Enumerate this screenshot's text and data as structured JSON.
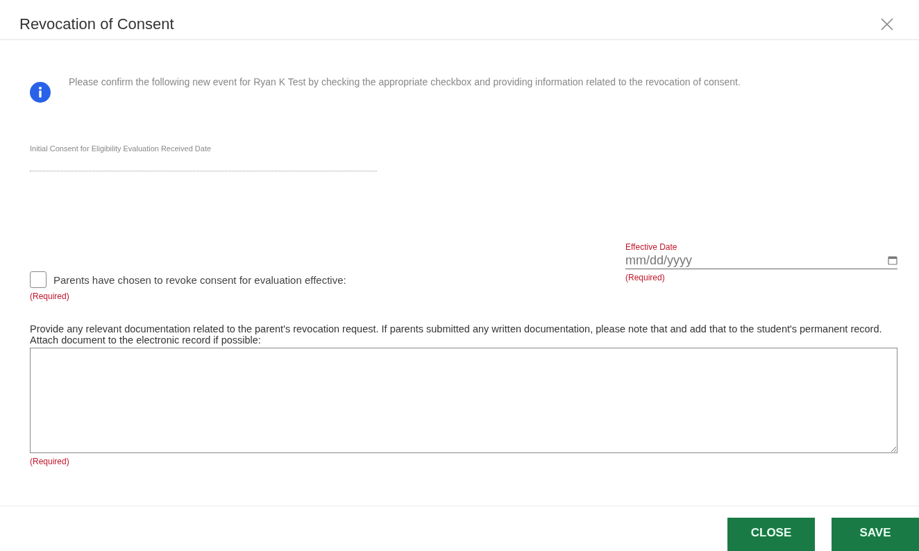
{
  "dialog": {
    "title": "Revocation of Consent"
  },
  "info": {
    "text": "Please confirm the following new event for Ryan K Test by checking the appropriate checkbox and providing information related to the revocation of consent."
  },
  "initial_consent_date": {
    "label": "Initial Consent for Eligibility Evaluation Received Date"
  },
  "revoke_checkbox": {
    "label": "Parents have chosen to revoke consent for evaluation effective:",
    "checked": false,
    "note": "(Required)"
  },
  "effective_date": {
    "label": "Effective Date",
    "placeholder": "mm/dd/yyyy",
    "note": "(Required)"
  },
  "documentation": {
    "label": "Provide any relevant documentation related to the parent's revocation request. If parents submitted any written documentation, please note that and add that to the student's permanent record. Attach document to the electronic record if possible:",
    "note": "(Required)"
  },
  "buttons": [
    "CLOSE",
    "SAVE"
  ]
}
